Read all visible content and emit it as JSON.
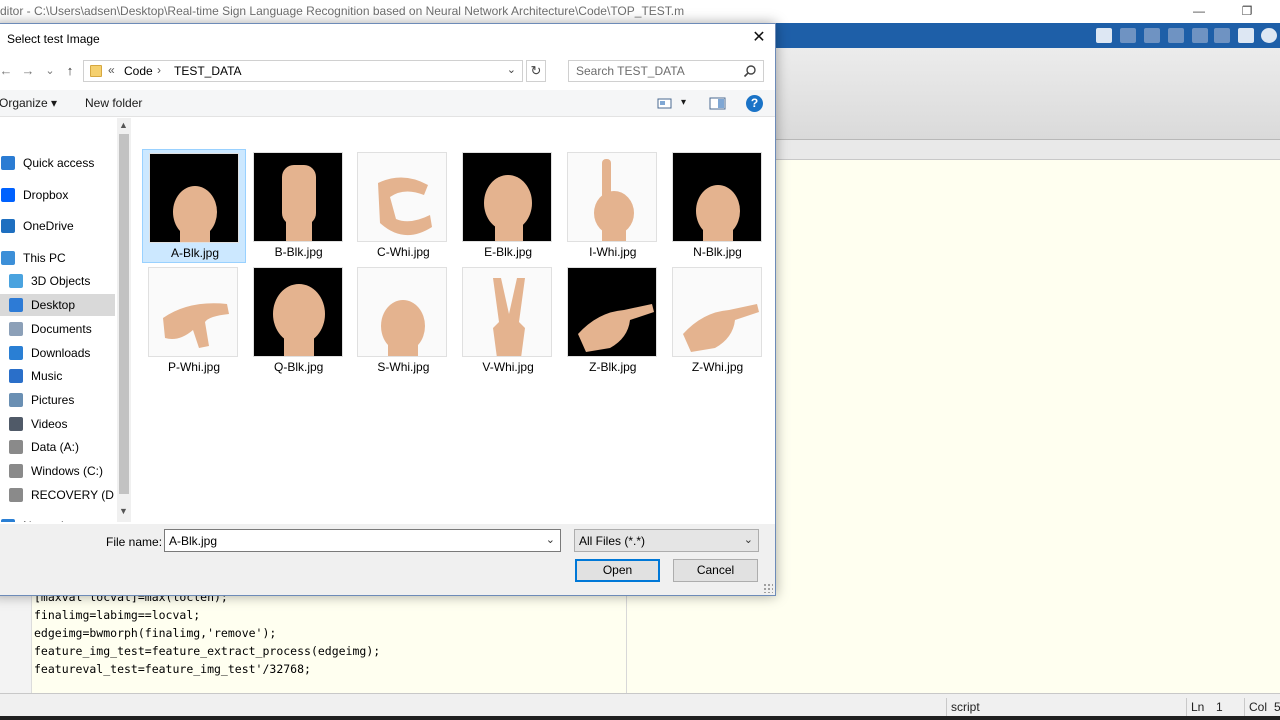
{
  "matlab": {
    "window_title": "ditor - C:\\Users\\adsen\\Desktop\\Real-time Sign Language Recognition based on Neural Network Architecture\\Code\\TOP_TEST.m",
    "restore_glyph": "❐",
    "code_lines": [
      "[maxval locval]=max(loclen);",
      "finalimg=labimg==locval;",
      "edgeimg=bwmorph(finalimg,'remove');",
      "feature_img_test=feature_extract_process(edgeimg);",
      "featureval_test=feature_img_test'/32768;"
    ],
    "status": {
      "mode": "script",
      "ln_label": "Ln",
      "ln_value": "1",
      "col_label": "Col",
      "col_value": "5"
    }
  },
  "dialog": {
    "title": "Select test Image",
    "close_glyph": "✕",
    "nav": {
      "back_glyph": "←",
      "forward_glyph": "→",
      "recent_glyph": "⌄",
      "up_glyph": "↑",
      "overflow_glyph": "«",
      "breadcrumb": [
        "Code",
        "TEST_DATA"
      ],
      "separator": "›",
      "dropdown_glyph": "⌄",
      "refresh_glyph": "↻",
      "search_placeholder": "Search TEST_DATA"
    },
    "toolbar": {
      "organize_label": "Organize ▾",
      "new_folder_label": "New folder",
      "view_dropdown_glyph": "▾",
      "help_glyph": "?"
    },
    "sidebar": [
      {
        "label": "Quick access",
        "icon": "star-icon",
        "color": "#2b7cd3"
      },
      {
        "label": "Dropbox",
        "icon": "dropbox-icon",
        "color": "#0061fe"
      },
      {
        "label": "OneDrive",
        "icon": "cloud-icon",
        "color": "#1e6fc0"
      },
      {
        "label": "This PC",
        "icon": "computer-icon",
        "color": "#3c8fd8"
      },
      {
        "label": "3D Objects",
        "icon": "cube-icon",
        "color": "#4aa3df"
      },
      {
        "label": "Desktop",
        "icon": "desktop-icon",
        "color": "#2d7bd6",
        "selected": true
      },
      {
        "label": "Documents",
        "icon": "document-icon",
        "color": "#8ca0b8"
      },
      {
        "label": "Downloads",
        "icon": "download-icon",
        "color": "#2a7fd4"
      },
      {
        "label": "Music",
        "icon": "music-icon",
        "color": "#2a6fc9"
      },
      {
        "label": "Pictures",
        "icon": "picture-icon",
        "color": "#6a8fb3"
      },
      {
        "label": "Videos",
        "icon": "video-icon",
        "color": "#505a68"
      },
      {
        "label": "Data (A:)",
        "icon": "drive-icon",
        "color": "#8a8a8a"
      },
      {
        "label": "Windows (C:)",
        "icon": "windows-drive-icon",
        "color": "#8a8a8a"
      },
      {
        "label": "RECOVERY (D:)",
        "icon": "drive-icon",
        "color": "#8a8a8a"
      },
      {
        "label": "Network",
        "icon": "network-icon",
        "color": "#2a7fd4"
      }
    ],
    "files": [
      {
        "name": "A-Blk.jpg",
        "bg": "blk",
        "gesture": "fist",
        "selected": true
      },
      {
        "name": "B-Blk.jpg",
        "bg": "blk",
        "gesture": "flat"
      },
      {
        "name": "C-Whi.jpg",
        "bg": "whi",
        "gesture": "c"
      },
      {
        "name": "E-Blk.jpg",
        "bg": "blk",
        "gesture": "curl"
      },
      {
        "name": "I-Whi.jpg",
        "bg": "whi",
        "gesture": "pinky"
      },
      {
        "name": "N-Blk.jpg",
        "bg": "blk",
        "gesture": "fist"
      },
      {
        "name": "P-Whi.jpg",
        "bg": "whi",
        "gesture": "point-down"
      },
      {
        "name": "Q-Blk.jpg",
        "bg": "blk",
        "gesture": "knuckles"
      },
      {
        "name": "S-Whi.jpg",
        "bg": "whi",
        "gesture": "fist"
      },
      {
        "name": "V-Whi.jpg",
        "bg": "whi",
        "gesture": "v"
      },
      {
        "name": "Z-Blk.jpg",
        "bg": "blk",
        "gesture": "point-side"
      },
      {
        "name": "Z-Whi.jpg",
        "bg": "whi",
        "gesture": "point-side"
      }
    ],
    "filename_label": "File name:",
    "filename_value": "A-Blk.jpg",
    "filetype_value": "All Files (*.*)",
    "dropdown_glyph": "⌄",
    "open_label": "Open",
    "cancel_label": "Cancel"
  },
  "colors": {
    "accent": "#0078d7",
    "matlab_blue": "#1e5fa8",
    "skin": "#e4b38f",
    "selected_tile": "#cce8ff"
  }
}
